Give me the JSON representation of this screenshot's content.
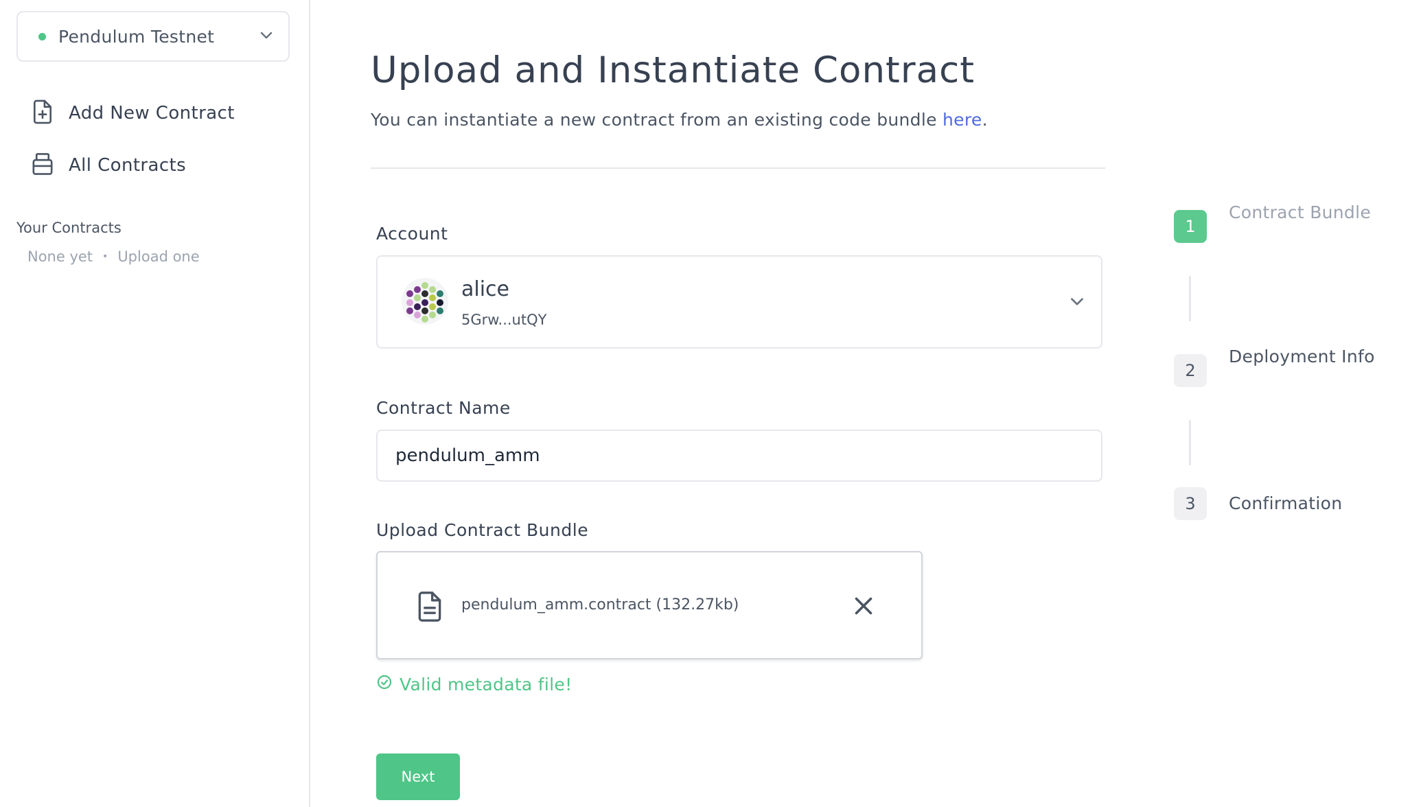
{
  "sidebar": {
    "network": {
      "label": "Pendulum Testnet",
      "status_color": "#4fc587"
    },
    "nav": [
      {
        "label": "Add New Contract",
        "icon": "file-plus-icon"
      },
      {
        "label": "All Contracts",
        "icon": "database-icon"
      }
    ],
    "your_contracts": {
      "title": "Your Contracts",
      "empty_text": "None yet",
      "separator": "•",
      "upload_link": "Upload one"
    }
  },
  "main": {
    "title": "Upload and Instantiate Contract",
    "subtitle": "You can instantiate a new contract from an existing code bundle ",
    "subtitle_link": "here",
    "subtitle_end": ".",
    "account": {
      "label": "Account",
      "name": "alice",
      "address": "5Grw...utQY"
    },
    "contract_name": {
      "label": "Contract Name",
      "value": "pendulum_amm"
    },
    "upload": {
      "label": "Upload Contract Bundle",
      "file_name": "pendulum_amm.contract (132.27kb)",
      "valid_message": "Valid metadata file!"
    },
    "next_button": "Next"
  },
  "stepper": [
    {
      "number": "1",
      "label": "Contract Bundle",
      "state": "active"
    },
    {
      "number": "2",
      "label": "Deployment Info",
      "state": "pending"
    },
    {
      "number": "3",
      "label": "Confirmation",
      "state": "pending"
    }
  ],
  "colors": {
    "accent_green": "#4fc587",
    "link_blue": "#4f6be0",
    "border": "#e5e7eb",
    "text": "#374151"
  }
}
